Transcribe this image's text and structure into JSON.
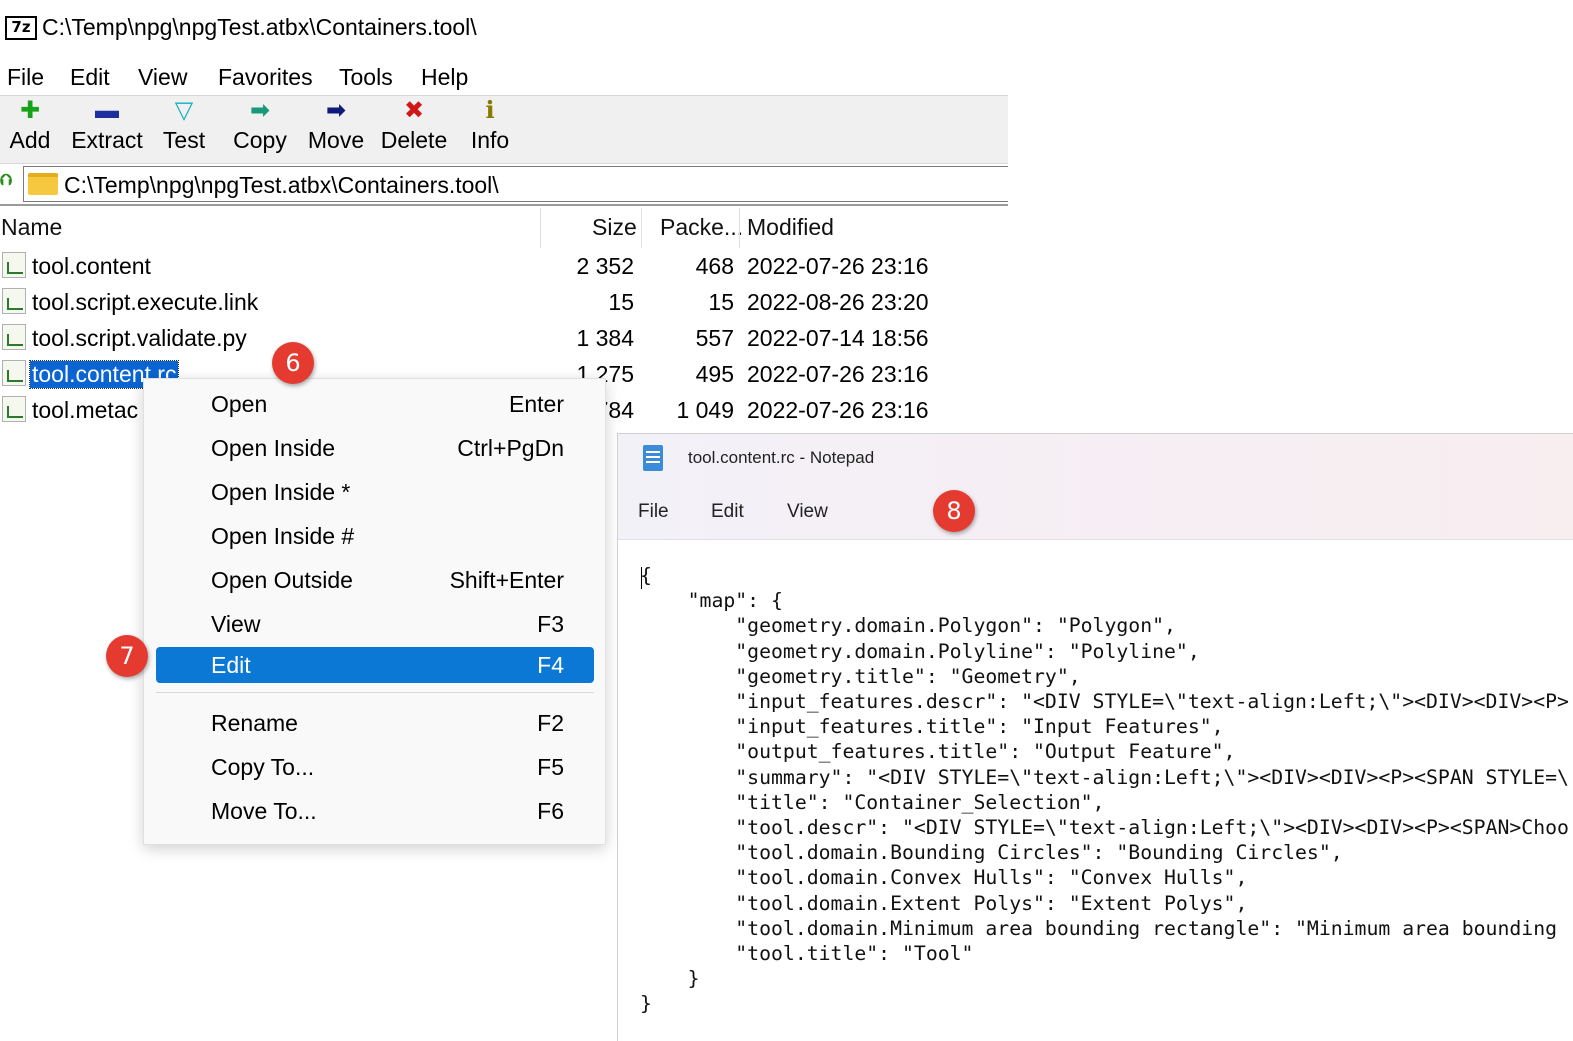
{
  "window": {
    "title": "C:\\Temp\\npg\\npgTest.atbx\\Containers.tool\\",
    "icon_text": "7z"
  },
  "menu": [
    "File",
    "Edit",
    "View",
    "Favorites",
    "Tools",
    "Help"
  ],
  "toolbar": [
    {
      "label": "Add",
      "icon": "plus-icon",
      "glyph": "✚",
      "color": "#1aa11a"
    },
    {
      "label": "Extract",
      "icon": "minus-icon",
      "glyph": "▬",
      "color": "#1c2f9c"
    },
    {
      "label": "Test",
      "icon": "checkmark-icon",
      "glyph": "▽",
      "color": "#10b0c0"
    },
    {
      "label": "Copy",
      "icon": "copy-arrow-icon",
      "glyph": "➡",
      "color": "#189a7a"
    },
    {
      "label": "Move",
      "icon": "move-arrow-icon",
      "glyph": "➡",
      "color": "#101a7a"
    },
    {
      "label": "Delete",
      "icon": "delete-x-icon",
      "glyph": "✖",
      "color": "#d01818"
    },
    {
      "label": "Info",
      "icon": "info-icon",
      "glyph": "ℹ",
      "color": "#8a7a00"
    }
  ],
  "address": {
    "path": "C:\\Temp\\npg\\npgTest.atbx\\Containers.tool\\"
  },
  "columns": {
    "name": "Name",
    "size": "Size",
    "packed": "Packe...",
    "modified": "Modified"
  },
  "files": [
    {
      "name": "tool.content",
      "size": "2 352",
      "packed": "468",
      "modified": "2022-07-26 23:16"
    },
    {
      "name": "tool.script.execute.link",
      "size": "15",
      "packed": "15",
      "modified": "2022-08-26 23:20"
    },
    {
      "name": "tool.script.validate.py",
      "size": "1 384",
      "packed": "557",
      "modified": "2022-07-14 18:56"
    },
    {
      "name": "tool.content.rc",
      "size": "1 275",
      "packed": "495",
      "modified": "2022-07-26 23:16"
    },
    {
      "name": "tool.metac",
      "size": "784",
      "packed": "1 049",
      "modified": "2022-07-26 23:16"
    }
  ],
  "context_menu": [
    {
      "label": "Open",
      "key": "Enter"
    },
    {
      "label": "Open Inside",
      "key": "Ctrl+PgDn"
    },
    {
      "label": "Open Inside *",
      "key": ""
    },
    {
      "label": "Open Inside #",
      "key": ""
    },
    {
      "label": "Open Outside",
      "key": "Shift+Enter"
    },
    {
      "label": "View",
      "key": "F3"
    },
    {
      "label": "Edit",
      "key": "F4"
    },
    {
      "label": "Rename",
      "key": "F2"
    },
    {
      "label": "Copy To...",
      "key": "F5"
    },
    {
      "label": "Move To...",
      "key": "F6"
    }
  ],
  "notepad": {
    "title": "tool.content.rc - Notepad",
    "menu": [
      "File",
      "Edit",
      "View"
    ],
    "lines": [
      "{",
      "    \"map\": {",
      "        \"geometry.domain.Polygon\": \"Polygon\",",
      "        \"geometry.domain.Polyline\": \"Polyline\",",
      "        \"geometry.title\": \"Geometry\",",
      "        \"input_features.descr\": \"<DIV STYLE=\\\"text-align:Left;\\\"><DIV><DIV><P>",
      "        \"input_features.title\": \"Input Features\",",
      "        \"output_features.title\": \"Output Feature\",",
      "        \"summary\": \"<DIV STYLE=\\\"text-align:Left;\\\"><DIV><DIV><P><SPAN STYLE=\\",
      "        \"title\": \"Container_Selection\",",
      "        \"tool.descr\": \"<DIV STYLE=\\\"text-align:Left;\\\"><DIV><DIV><P><SPAN>Choo",
      "        \"tool.domain.Bounding Circles\": \"Bounding Circles\",",
      "        \"tool.domain.Convex Hulls\": \"Convex Hulls\",",
      "        \"tool.domain.Extent Polys\": \"Extent Polys\",",
      "        \"tool.domain.Minimum area bounding rectangle\": \"Minimum area bounding",
      "        \"tool.title\": \"Tool\"",
      "    }",
      "}"
    ]
  },
  "badges": [
    "6",
    "7",
    "8"
  ]
}
